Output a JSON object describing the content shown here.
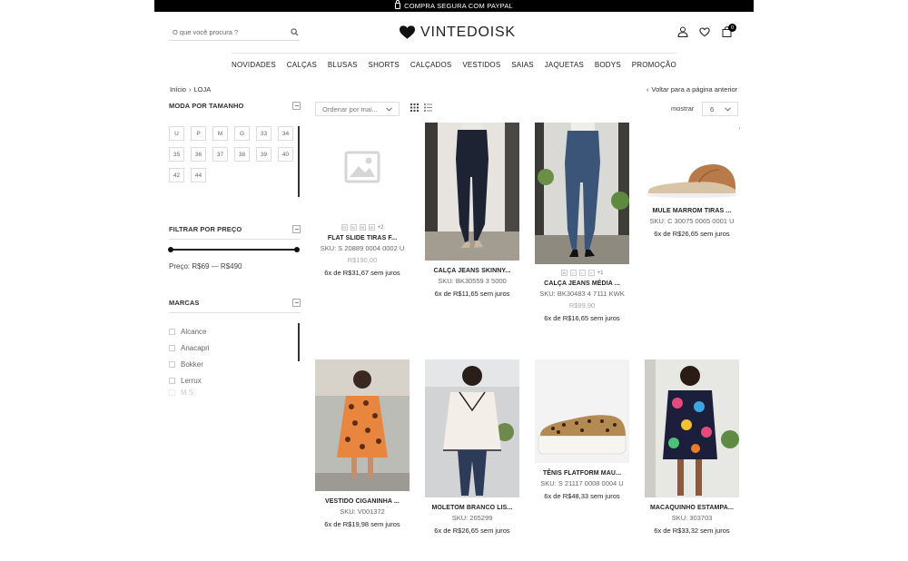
{
  "topbar": {
    "text": "COMPRA SEGURA COM PAYPAL"
  },
  "search": {
    "placeholder": "O que você procura ?"
  },
  "brand": {
    "name": "VINTEDOISK"
  },
  "cart": {
    "count": "0"
  },
  "nav": [
    "NOVIDADES",
    "CALÇAS",
    "BLUSAS",
    "SHORTS",
    "CALÇADOS",
    "VESTIDOS",
    "SAIAS",
    "JAQUETAS",
    "BODYS",
    "PROMOÇÃO"
  ],
  "breadcrumb": {
    "home": "Início",
    "separator": "›",
    "current": "LOJA"
  },
  "back": {
    "arrow": "‹",
    "label": "Voltar para a página anterior"
  },
  "filters": {
    "size_title": "MODA POR TAMANHO",
    "sizes": [
      "U",
      "P",
      "M",
      "G",
      "33",
      "34",
      "35",
      "36",
      "37",
      "38",
      "39",
      "40",
      "42",
      "44"
    ],
    "price_title": "FILTRAR POR PREÇO",
    "price_range": {
      "min": 69,
      "max": 490,
      "selected_min": 69,
      "selected_max": 490
    },
    "price_label": "Preço: R$69 — R$490",
    "brand_title": "MARCAS",
    "brands": [
      "Alcance",
      "Anacapri",
      "Bokker",
      "Lerrux"
    ],
    "brand_partial": "M.S"
  },
  "toolbar": {
    "sort_label": "Ordenar por mai...",
    "show_label": "mostrar",
    "show_value": "6"
  },
  "products": [
    {
      "name": "FLAT SLIDE TIRAS F...",
      "sku": "SKU: S 20889 0004 0002 U",
      "old_price": "R$190,00",
      "installments": "6x de R$31,67 sem juros",
      "swatches": [
        "33",
        "34",
        "35",
        "36"
      ],
      "more": "+2"
    },
    {
      "name": "CALÇA JEANS SKINNY...",
      "sku": "SKU: BK30559 3 5000",
      "installments": "6x de R$11,65 sem juros"
    },
    {
      "name": "CALÇA JEANS MÉDIA ...",
      "sku": "SKU: BK30483 4 7111 KWK",
      "old_price": "R$99,90",
      "installments": "6x de R$16,65 sem juros",
      "swatches": [
        "36",
        "×",
        "×",
        "×"
      ],
      "more": "+1"
    },
    {
      "name": "MULE MARROM TIRAS ...",
      "sku": "SKU: C 30075 0065 0001 U",
      "installments": "6x de R$26,65 sem juros"
    },
    {
      "name": "VESTIDO CIGANINHA ...",
      "sku": "SKU: V001372",
      "installments": "6x de R$19,98 sem juros"
    },
    {
      "name": "MOLETOM BRANCO LIS...",
      "sku": "SKU: 265299",
      "installments": "6x de R$26,65 sem juros"
    },
    {
      "name": "TÊNIS FLATFORM MAU...",
      "sku": "SKU: S 21117 0008 0004 U",
      "installments": "6x de R$48,33 sem juros"
    },
    {
      "name": "MACAQUINHO ESTAMPA...",
      "sku": "SKU: 303703",
      "installments": "6x de R$33,32 sem juros"
    }
  ]
}
